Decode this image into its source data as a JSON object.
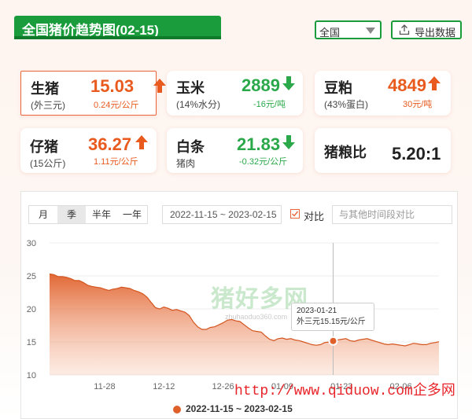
{
  "header": {
    "title": "全国猪价趋势图(02-15)",
    "region_select": "全国",
    "export_label": "导出数据"
  },
  "cards": [
    {
      "name": "生猪",
      "sub": "(外三元)",
      "price": "15.03",
      "change": "0.24元/公斤",
      "trend": "up"
    },
    {
      "name": "玉米",
      "sub": "(14%水分)",
      "price": "2889",
      "change": "-16元/吨",
      "trend": "down"
    },
    {
      "name": "豆粕",
      "sub": "(43%蛋白)",
      "price": "4849",
      "change": "30元/吨",
      "trend": "up"
    },
    {
      "name": "仔猪",
      "sub": "(15公斤)",
      "price": "36.27",
      "change": "1.11元/公斤",
      "trend": "up"
    },
    {
      "name": "白条",
      "sub": "猪肉",
      "price": "21.83",
      "change": "-0.32元/公斤",
      "trend": "down"
    },
    {
      "name": "猪粮比",
      "sub": "",
      "price": "5.20:1",
      "change": "",
      "trend": "none"
    }
  ],
  "controls": {
    "periods": [
      "月",
      "季",
      "半年",
      "一年"
    ],
    "selected_period": "季",
    "date_range": "2022-11-15 ~ 2023-02-15",
    "compare_label": "对比",
    "compare_placeholder": "与其他时间段对比"
  },
  "tooltip": {
    "date": "2023-01-21",
    "text": "外三元15.15元/公斤"
  },
  "watermark": {
    "logo": "猪好多网",
    "domain": "zhuhaoduo360.com"
  },
  "site_watermark": "http://www.qiduow.com企多网",
  "colors": {
    "accent": "#e85a1e",
    "green": "#1a9c3c",
    "line": "#e0602a"
  },
  "chart_data": {
    "type": "area",
    "x_ticks": [
      "11-28",
      "12-12",
      "12-26",
      "01-09",
      "01-23",
      "02-06"
    ],
    "y_ticks": [
      10,
      15,
      20,
      25,
      30
    ],
    "ylim": [
      10,
      30
    ],
    "legend": "2022-11-15 ~ 2023-02-15",
    "highlight": {
      "x": "01-21",
      "y": 15.15
    },
    "series": [
      {
        "name": "2022-11-15 ~ 2023-02-15",
        "x": [
          "11-15",
          "11-16",
          "11-17",
          "11-18",
          "11-19",
          "11-20",
          "11-21",
          "11-22",
          "11-23",
          "11-24",
          "11-25",
          "11-26",
          "11-27",
          "11-28",
          "11-29",
          "11-30",
          "12-01",
          "12-02",
          "12-03",
          "12-04",
          "12-05",
          "12-06",
          "12-07",
          "12-08",
          "12-09",
          "12-10",
          "12-11",
          "12-12",
          "12-13",
          "12-14",
          "12-15",
          "12-16",
          "12-17",
          "12-18",
          "12-19",
          "12-20",
          "12-21",
          "12-22",
          "12-23",
          "12-24",
          "12-25",
          "12-26",
          "12-27",
          "12-28",
          "12-29",
          "12-30",
          "12-31",
          "01-01",
          "01-02",
          "01-03",
          "01-04",
          "01-05",
          "01-06",
          "01-07",
          "01-08",
          "01-09",
          "01-10",
          "01-11",
          "01-12",
          "01-13",
          "01-14",
          "01-15",
          "01-16",
          "01-17",
          "01-18",
          "01-19",
          "01-20",
          "01-21",
          "01-22",
          "01-23",
          "01-24",
          "01-25",
          "01-26",
          "01-27",
          "01-28",
          "01-29",
          "01-30",
          "01-31",
          "02-01",
          "02-02",
          "02-03",
          "02-04",
          "02-05",
          "02-06",
          "02-07",
          "02-08",
          "02-09",
          "02-10",
          "02-11",
          "02-12",
          "02-13",
          "02-14",
          "02-15"
        ],
        "values": [
          25.3,
          25.2,
          24.9,
          24.9,
          24.8,
          24.6,
          24.3,
          24.3,
          24.0,
          23.6,
          23.4,
          23.3,
          23.2,
          23.0,
          22.8,
          23.0,
          23.1,
          23.3,
          23.2,
          23.1,
          22.8,
          22.6,
          22.3,
          21.8,
          21.0,
          20.2,
          20.0,
          20.3,
          20.1,
          19.8,
          19.9,
          19.7,
          19.5,
          19.0,
          18.0,
          17.3,
          16.9,
          16.9,
          17.2,
          17.3,
          17.6,
          17.9,
          18.3,
          18.4,
          18.2,
          18.1,
          17.6,
          17.1,
          16.7,
          16.6,
          16.5,
          15.9,
          15.4,
          15.2,
          15.5,
          15.6,
          15.4,
          15.5,
          15.3,
          15.2,
          15.0,
          14.8,
          14.6,
          14.5,
          14.6,
          14.9,
          15.0,
          15.15,
          15.3,
          15.4,
          15.5,
          15.2,
          15.1,
          15.3,
          15.4,
          15.5,
          15.3,
          15.1,
          14.9,
          14.7,
          14.6,
          14.7,
          14.6,
          14.5,
          14.4,
          14.6,
          14.8,
          14.7,
          14.6,
          14.6,
          14.8,
          14.9,
          15.03
        ]
      }
    ]
  }
}
